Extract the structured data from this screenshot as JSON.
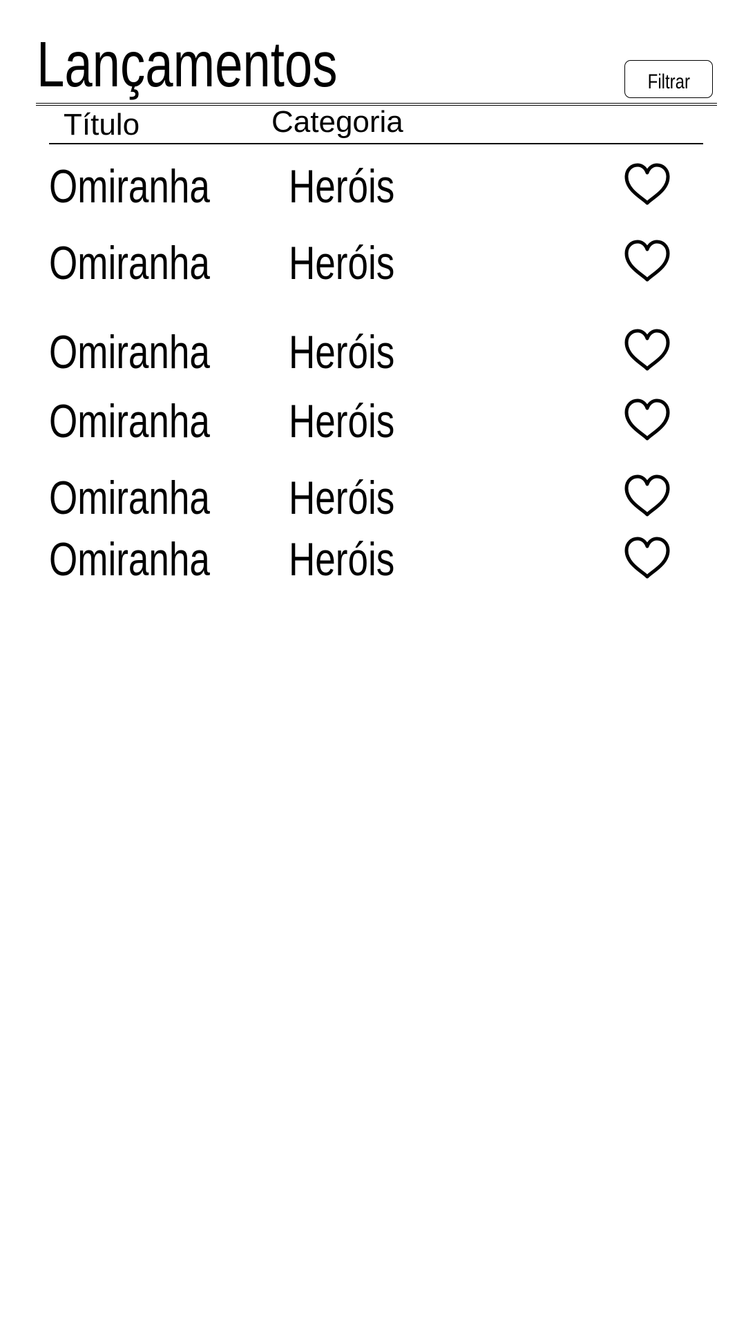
{
  "header": {
    "title": "Lançamentos",
    "filter_label": "Filtrar"
  },
  "table": {
    "columns": [
      "Título",
      "Categoria"
    ],
    "rows": [
      {
        "title": "Omiranha",
        "category": "Heróis",
        "favorite_icon": "heart-outline-icon"
      },
      {
        "title": "Omiranha",
        "category": "Heróis",
        "favorite_icon": "heart-outline-icon"
      },
      {
        "title": "Omiranha",
        "category": "Heróis",
        "favorite_icon": "heart-outline-icon"
      },
      {
        "title": "Omiranha",
        "category": "Heróis",
        "favorite_icon": "heart-outline-icon"
      },
      {
        "title": "Omiranha",
        "category": "Heróis",
        "favorite_icon": "heart-outline-icon"
      },
      {
        "title": "Omiranha",
        "category": "Heróis",
        "favorite_icon": "heart-outline-icon"
      }
    ]
  }
}
